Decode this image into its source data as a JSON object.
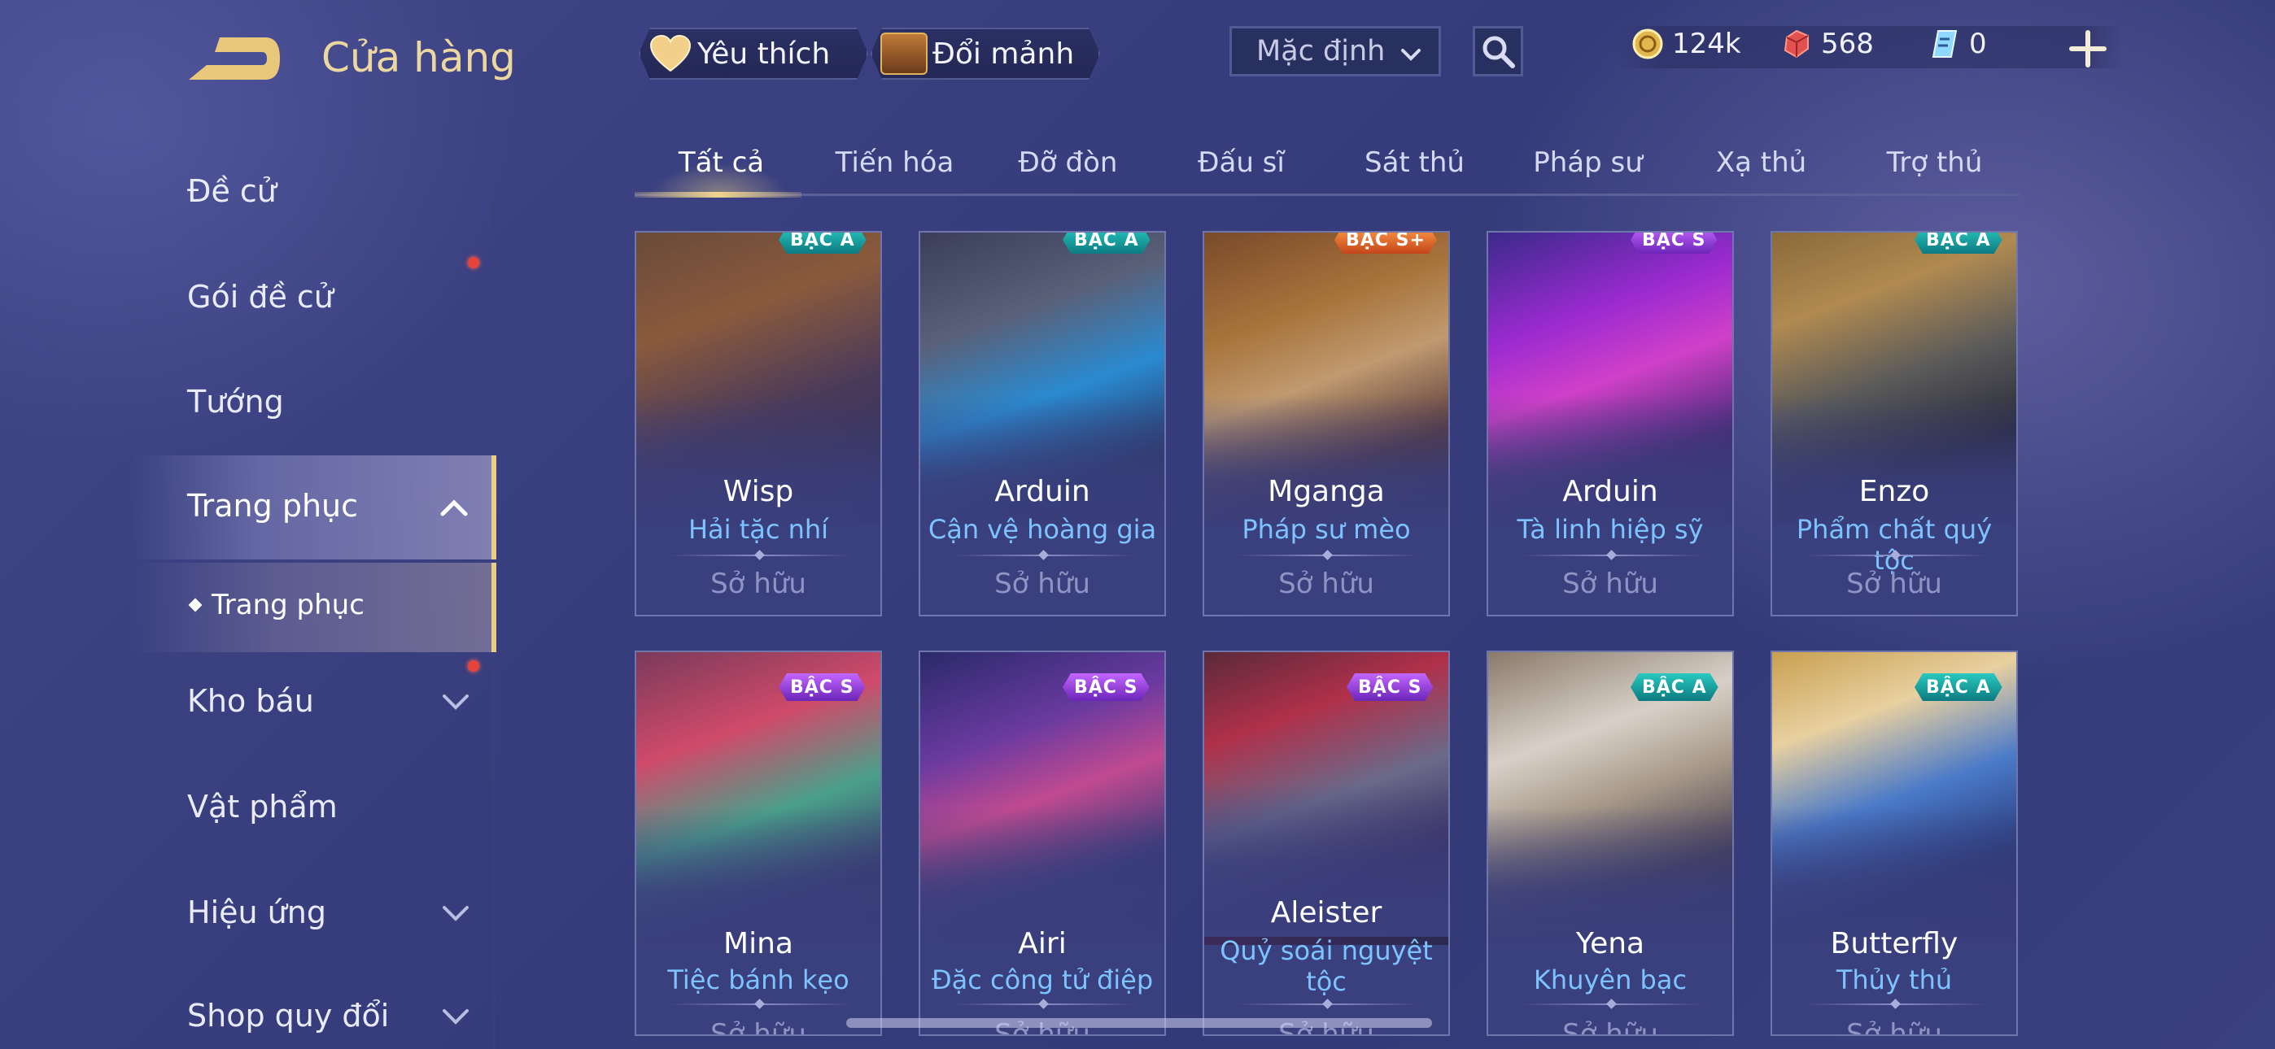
{
  "header": {
    "title": "Cửa hàng",
    "favorites_label": "Yêu thích",
    "exchange_label": "Đổi mảnh",
    "sort_selected": "Mặc định",
    "currencies": {
      "gold": "124k",
      "ruby": "568",
      "ticket": "0"
    }
  },
  "sidebar": {
    "items": [
      {
        "label": "Đề cử"
      },
      {
        "label": "Gói đề cử"
      },
      {
        "label": "Tướng"
      },
      {
        "label": "Trang phục"
      },
      {
        "label": "Kho báu"
      },
      {
        "label": "Vật phẩm"
      },
      {
        "label": "Hiệu ứng"
      },
      {
        "label": "Shop quy đổi"
      }
    ],
    "sub_item": "Trang phục"
  },
  "tabs": [
    {
      "label": "Tất cả"
    },
    {
      "label": "Tiến hóa"
    },
    {
      "label": "Đỡ đòn"
    },
    {
      "label": "Đấu sĩ"
    },
    {
      "label": "Sát thủ"
    },
    {
      "label": "Pháp sư"
    },
    {
      "label": "Xạ thủ"
    },
    {
      "label": "Trợ thủ"
    }
  ],
  "cards": [
    {
      "hero": "Wisp",
      "skin": "Hải tặc nhí",
      "tier": "BẬC A",
      "status": "Sở hữu"
    },
    {
      "hero": "Arduin",
      "skin": "Cận vệ hoàng gia",
      "tier": "BẬC A",
      "status": "Sở hữu"
    },
    {
      "hero": "Mganga",
      "skin": "Pháp sư mèo",
      "tier": "BẬC S+",
      "status": "Sở hữu"
    },
    {
      "hero": "Arduin",
      "skin": "Tà linh hiệp sỹ",
      "tier": "BẬC S",
      "status": "Sở hữu"
    },
    {
      "hero": "Enzo",
      "skin": "Phẩm chất quý tộc",
      "tier": "BẬC A",
      "status": "Sở hữu"
    },
    {
      "hero": "Mina",
      "skin": "Tiệc bánh kẹo",
      "tier": "BẬC S",
      "status": "Sở hữu"
    },
    {
      "hero": "Airi",
      "skin": "Đặc công tử điệp",
      "tier": "BẬC S",
      "status": "Sở hữu"
    },
    {
      "hero": "Aleister",
      "skin": "Quỷ soái nguyệt tộc",
      "tier": "BẬC S",
      "status": "Sở hữu"
    },
    {
      "hero": "Yena",
      "skin": "Khuyên bạc",
      "tier": "BẬC A",
      "status": "Sở hữu"
    },
    {
      "hero": "Butterfly",
      "skin": "Thủy thủ",
      "tier": "BẬC A",
      "status": "Sở hữu"
    }
  ],
  "icons": {
    "back": "back-arrow-icon",
    "favorites": "heart-icon",
    "exchange": "treasure-chest-icon",
    "sort": "chevron-down-icon",
    "search": "search-icon",
    "gold": "gold-coin-icon",
    "ruby": "ruby-gem-icon",
    "ticket": "voucher-ticket-icon",
    "add": "plus-icon"
  },
  "colors": {
    "accent_gold": "#e9cf86",
    "skin_name": "#7cc3ff",
    "tier_a": "#1aa6a6",
    "tier_s": "#9b46e0",
    "tier_sp": "#e06a2a",
    "notification": "#e8433b"
  }
}
